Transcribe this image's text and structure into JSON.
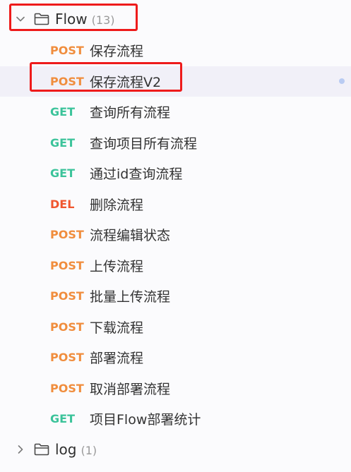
{
  "folders": {
    "flow": {
      "name": "Flow",
      "count": "(13)",
      "expanded": true,
      "icon": "folder-open-icon",
      "chevron": "chevron-down-icon"
    },
    "log": {
      "name": "log",
      "count": "(1)",
      "expanded": false,
      "icon": "folder-icon",
      "chevron": "chevron-right-icon"
    }
  },
  "apis": [
    {
      "method": "POST",
      "name": "保存流程"
    },
    {
      "method": "POST",
      "name": "保存流程V2",
      "selected": true
    },
    {
      "method": "GET",
      "name": "查询所有流程"
    },
    {
      "method": "GET",
      "name": "查询项目所有流程"
    },
    {
      "method": "GET",
      "name": "通过id查询流程"
    },
    {
      "method": "DEL",
      "name": "删除流程"
    },
    {
      "method": "POST",
      "name": "流程编辑状态"
    },
    {
      "method": "POST",
      "name": "上传流程"
    },
    {
      "method": "POST",
      "name": "批量上传流程"
    },
    {
      "method": "POST",
      "name": "下载流程"
    },
    {
      "method": "POST",
      "name": "部署流程"
    },
    {
      "method": "POST",
      "name": "取消部署流程"
    },
    {
      "method": "GET",
      "name": "项目Flow部署统计"
    }
  ],
  "colors": {
    "post": "#f08d3d",
    "get": "#3bc39a",
    "del": "#f0562e",
    "selected_bg": "#f1f0f8",
    "annotation": "#ee1b1b",
    "indicator_dot": "#b9cbf2"
  }
}
